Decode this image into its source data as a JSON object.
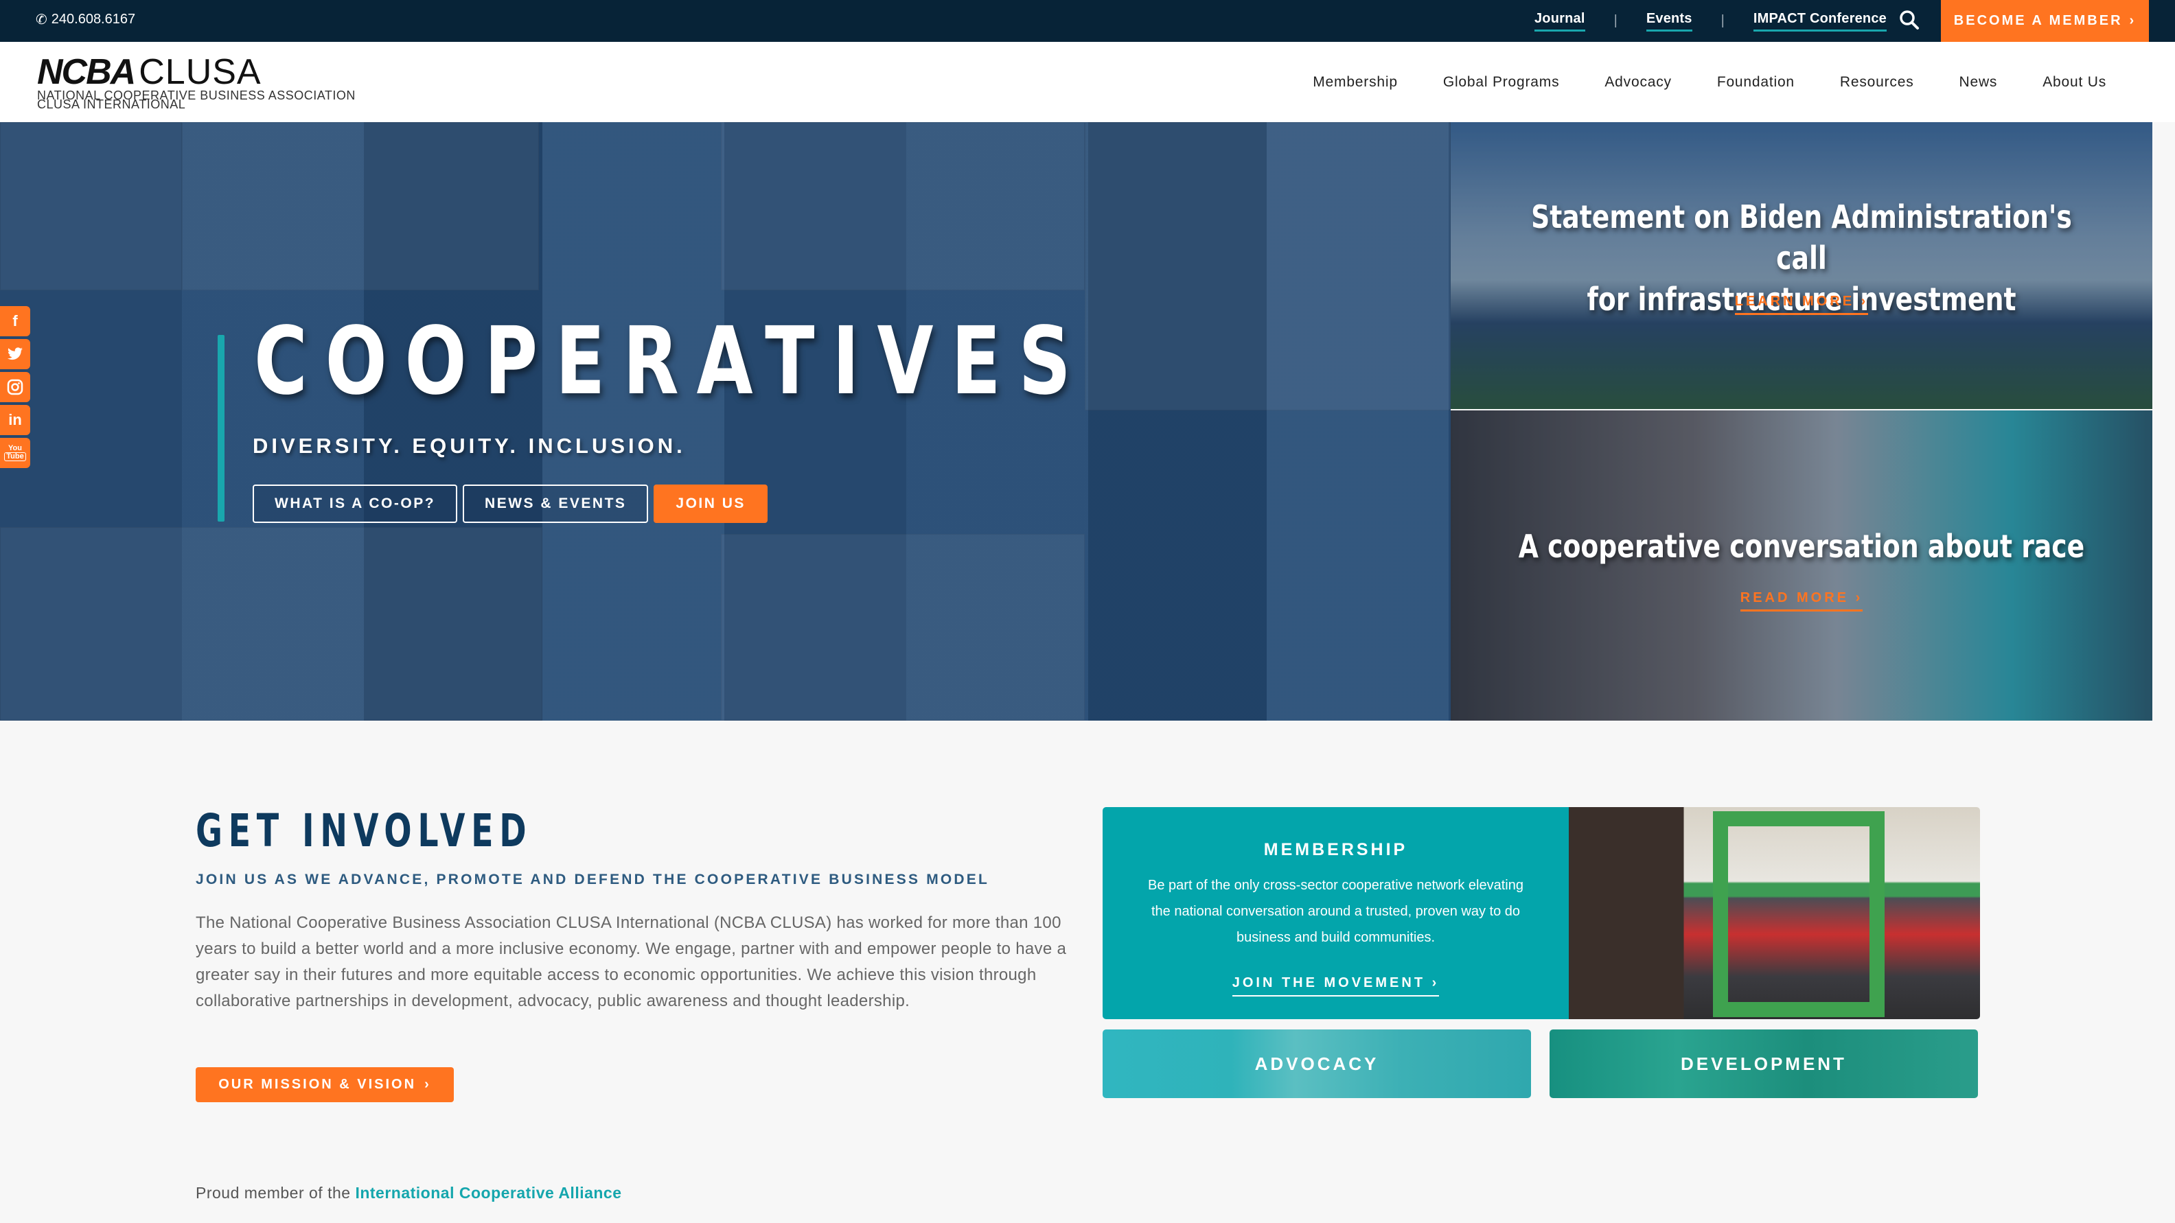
{
  "utility_bar": {
    "phone": "240.608.6167",
    "phone_icon": "phone-icon",
    "links": [
      {
        "label": "Journal"
      },
      {
        "label": "Events"
      },
      {
        "label": "IMPACT Conference"
      }
    ],
    "separator": "|",
    "search_icon": "search-icon",
    "cta": "BECOME A MEMBER",
    "cta_chevron": "›"
  },
  "header": {
    "logo_main": "NCBA",
    "logo_secondary": "CLUSA",
    "logo_sub1": "NATIONAL COOPERATIVE BUSINESS ASSOCIATION",
    "logo_sub2": "CLUSA INTERNATIONAL",
    "nav": [
      {
        "label": "Membership"
      },
      {
        "label": "Global Programs"
      },
      {
        "label": "Advocacy"
      },
      {
        "label": "Foundation"
      },
      {
        "label": "Resources"
      },
      {
        "label": "News"
      },
      {
        "label": "About Us"
      }
    ]
  },
  "social": [
    {
      "name": "facebook",
      "glyph": "f"
    },
    {
      "name": "twitter",
      "glyph": "t"
    },
    {
      "name": "instagram",
      "glyph": "◎"
    },
    {
      "name": "linkedin",
      "glyph": "in"
    },
    {
      "name": "youtube",
      "glyph": "▶"
    }
  ],
  "hero": {
    "title": "COOPERATIVES",
    "subtitle": "DIVERSITY. EQUITY. INCLUSION.",
    "buttons": [
      {
        "label": "WHAT IS A CO-OP?"
      },
      {
        "label": "NEWS & EVENTS"
      },
      {
        "label": "JOIN US"
      }
    ]
  },
  "features": [
    {
      "title_line1": "Statement on Biden Administration's call",
      "title_line2": "for infrastructure investment",
      "link": "LEARN MORE",
      "chevron": "›"
    },
    {
      "title_line1": "A cooperative conversation about race",
      "title_line2": "",
      "link": "READ MORE",
      "chevron": "›"
    }
  ],
  "get_involved": {
    "title": "GET INVOLVED",
    "subtitle": "JOIN US AS WE ADVANCE, PROMOTE AND DEFEND THE COOPERATIVE BUSINESS MODEL",
    "body": "The National Cooperative Business Association CLUSA International (NCBA CLUSA) has worked for more than 100 years to build a better world and a more inclusive economy. We engage, partner with and empower people to have a greater say in their futures and more equitable access to economic opportunities. We achieve this vision through collaborative partnerships in development, advocacy, public awareness and thought leadership.",
    "button": "OUR MISSION & VISION",
    "button_chevron": "›",
    "proud_prefix": "Proud member of the",
    "proud_link": "International Cooperative Alliance"
  },
  "membership_card": {
    "title": "MEMBERSHIP",
    "description": "Be part of the only cross-sector cooperative network elevating the national conversation around a trusted, proven way to do business and build communities.",
    "link": "JOIN THE MOVEMENT",
    "chevron": "›"
  },
  "tiles": [
    {
      "label": "ADVOCACY"
    },
    {
      "label": "DEVELOPMENT"
    }
  ],
  "colors": {
    "navy": "#072337",
    "orange": "#ff7420",
    "teal": "#03a5ab",
    "heading_blue": "#0e3a5e"
  }
}
